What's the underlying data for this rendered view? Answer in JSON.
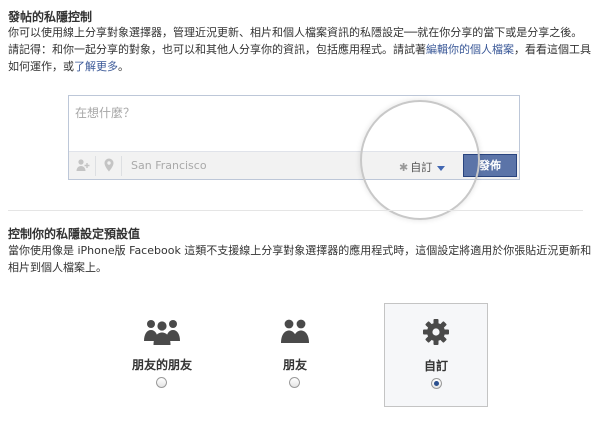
{
  "section1": {
    "title": "發帖的私隱控制",
    "text_before_link1": "你可以使用線上分享對象選擇器，管理近況更新、相片和個人檔案資訊的私隱設定──就在你分享的當下或是分享之後。請記得：和你一起分享的對象，也可以和其他人分享你的資訊，包括應用程式。請試著",
    "link1": "編輯你的個人檔案",
    "text_between": "，看看這個工具如何運作，或",
    "link2": "了解更多",
    "text_end": "。"
  },
  "composer": {
    "placeholder": "在想什麼？",
    "location": "San Francisco",
    "privacy_label": "自訂",
    "post_button": "發佈"
  },
  "section2": {
    "title": "控制你的私隱設定預設值",
    "text": "當你使用像是 iPhone版 Facebook 這類不支援線上分享對象選擇器的應用程式時，這個設定將適用於你張貼近況更新和相片到個人檔案上。"
  },
  "options": [
    {
      "label": "朋友的朋友",
      "icon": "friends-of-friends-icon",
      "selected": false
    },
    {
      "label": "朋友",
      "icon": "friends-icon",
      "selected": false
    },
    {
      "label": "自訂",
      "icon": "gear-icon",
      "selected": true
    }
  ],
  "colors": {
    "link": "#3b5998",
    "button": "#5b74a8",
    "icon": "#4a4a4a"
  }
}
